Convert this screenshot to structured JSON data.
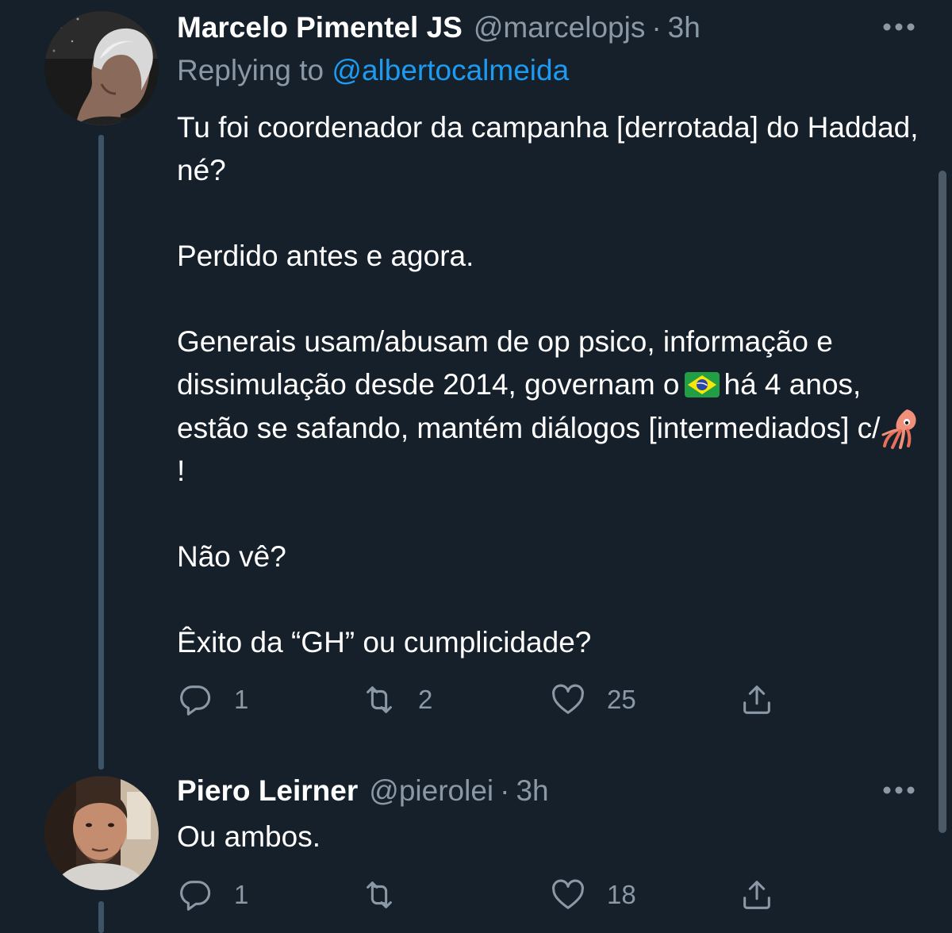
{
  "tweets": [
    {
      "author": {
        "name": "Marcelo Pimentel JS",
        "handle": "@marcelopjs",
        "separator": "·",
        "time": "3h",
        "avatar_icon": "avatar-grey-haired-man-icon"
      },
      "replying_to": {
        "prefix": "Replying to",
        "mention": "@albertocalmeida"
      },
      "paragraphs": [
        "Tu foi coordenador da campanha [derrotada] do Haddad, né?",
        "Perdido antes e agora.",
        {
          "part1": "Generais usam/abusam de op psico, informação e dissimulação desde 2014, governam o",
          "flag_icon": "brazil-flag-icon",
          "part2": "há 4 anos, estão se safando, mantém diálogos [intermediados] c/",
          "emoji_icon": "squid-emoji-icon",
          "part3": "!"
        },
        "Não vê?",
        "Êxito da “GH” ou cumplicidade?"
      ],
      "actions": {
        "reply_count": "1",
        "retweet_count": "2",
        "like_count": "25",
        "share_icon": "share-icon"
      }
    },
    {
      "author": {
        "name": "Piero Leirner",
        "handle": "@pierolei",
        "separator": "·",
        "time": "3h",
        "avatar_icon": "avatar-man-icon"
      },
      "text": "Ou ambos.",
      "actions": {
        "reply_count": "1",
        "retweet_count": "",
        "like_count": "18",
        "share_icon": "share-icon"
      }
    }
  ],
  "colors": {
    "background": "#15202b",
    "text_primary": "#ffffff",
    "text_secondary": "#8b98a5",
    "link": "#1d9bf0",
    "thread_line": "#3d5466"
  }
}
